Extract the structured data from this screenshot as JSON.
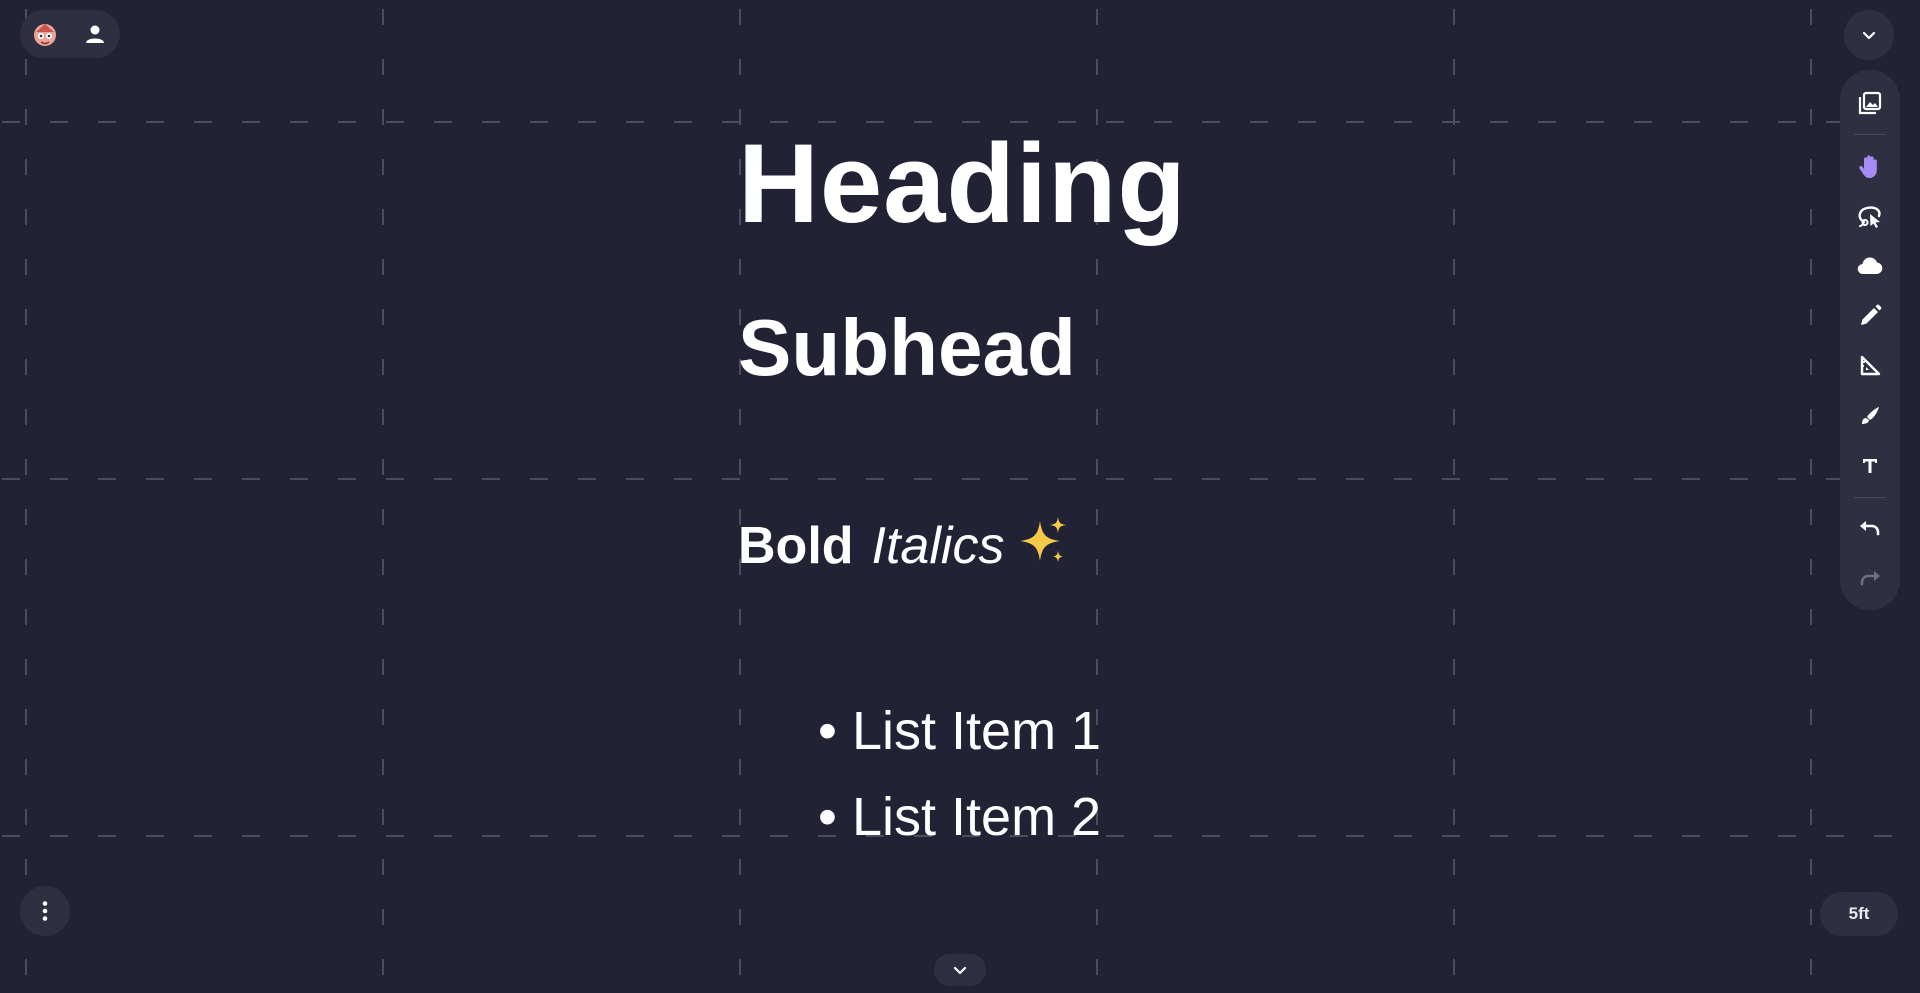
{
  "canvas": {
    "heading": "Heading",
    "subhead": "Subhead",
    "bold_text": "Bold",
    "italic_text": "Italics",
    "list_items": [
      "List Item 1",
      "List Item 2"
    ]
  },
  "top_left": {
    "icons": [
      "logo-icon",
      "user-icon"
    ]
  },
  "toolbar": {
    "tools": [
      "image-icon",
      "hand-icon",
      "lasso-select-icon",
      "cloud-icon",
      "pen-icon",
      "ruler-icon",
      "brush-icon",
      "text-icon",
      "undo-icon",
      "redo-icon"
    ],
    "active_tool": "hand-icon"
  },
  "scale_label": "5ft",
  "colors": {
    "background": "#212334",
    "grid_line": "#4b4d5f",
    "panel": "#2e3042",
    "active_accent": "#a58cf5",
    "text": "#ffffff"
  }
}
